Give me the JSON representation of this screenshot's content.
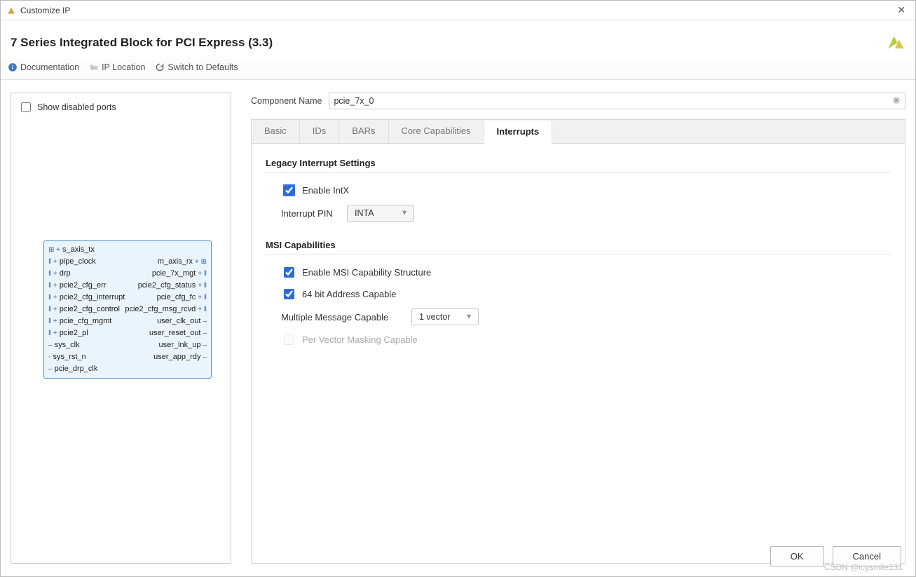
{
  "window": {
    "title": "Customize IP"
  },
  "page_title": "7 Series Integrated Block for PCI Express (3.3)",
  "toolbar": {
    "documentation": "Documentation",
    "ip_location": "IP Location",
    "switch_defaults": "Switch to Defaults"
  },
  "left": {
    "show_disabled_ports": "Show disabled ports",
    "ports_left": [
      "s_axis_tx",
      "pipe_clock",
      "drp",
      "pcie2_cfg_err",
      "pcie2_cfg_interrupt",
      "pcie2_cfg_control",
      "pcie_cfg_mgmt",
      "pcie2_pl",
      "sys_clk",
      "sys_rst_n",
      "pcie_drp_clk"
    ],
    "ports_right": [
      "",
      "m_axis_rx",
      "pcie_7x_mgt",
      "pcie2_cfg_status",
      "pcie_cfg_fc",
      "pcie2_cfg_msg_rcvd",
      "user_clk_out",
      "user_reset_out",
      "user_lnk_up",
      "user_app_rdy",
      ""
    ]
  },
  "component_name": {
    "label": "Component Name",
    "value": "pcie_7x_0"
  },
  "tabs": [
    "Basic",
    "IDs",
    "BARs",
    "Core Capabilities",
    "Interrupts"
  ],
  "active_tab": "Interrupts",
  "interrupts": {
    "legacy_title": "Legacy Interrupt Settings",
    "enable_intx": "Enable IntX",
    "interrupt_pin_label": "Interrupt PIN",
    "interrupt_pin_value": "INTA",
    "msi_title": "MSI Capabilities",
    "enable_msi": "Enable MSI Capability Structure",
    "addr64": "64 bit Address Capable",
    "mmc_label": "Multiple Message Capable",
    "mmc_value": "1 vector",
    "per_vector": "Per Vector Masking Capable"
  },
  "buttons": {
    "ok": "OK",
    "cancel": "Cancel"
  },
  "watermark": "CSDN @icysmile131"
}
